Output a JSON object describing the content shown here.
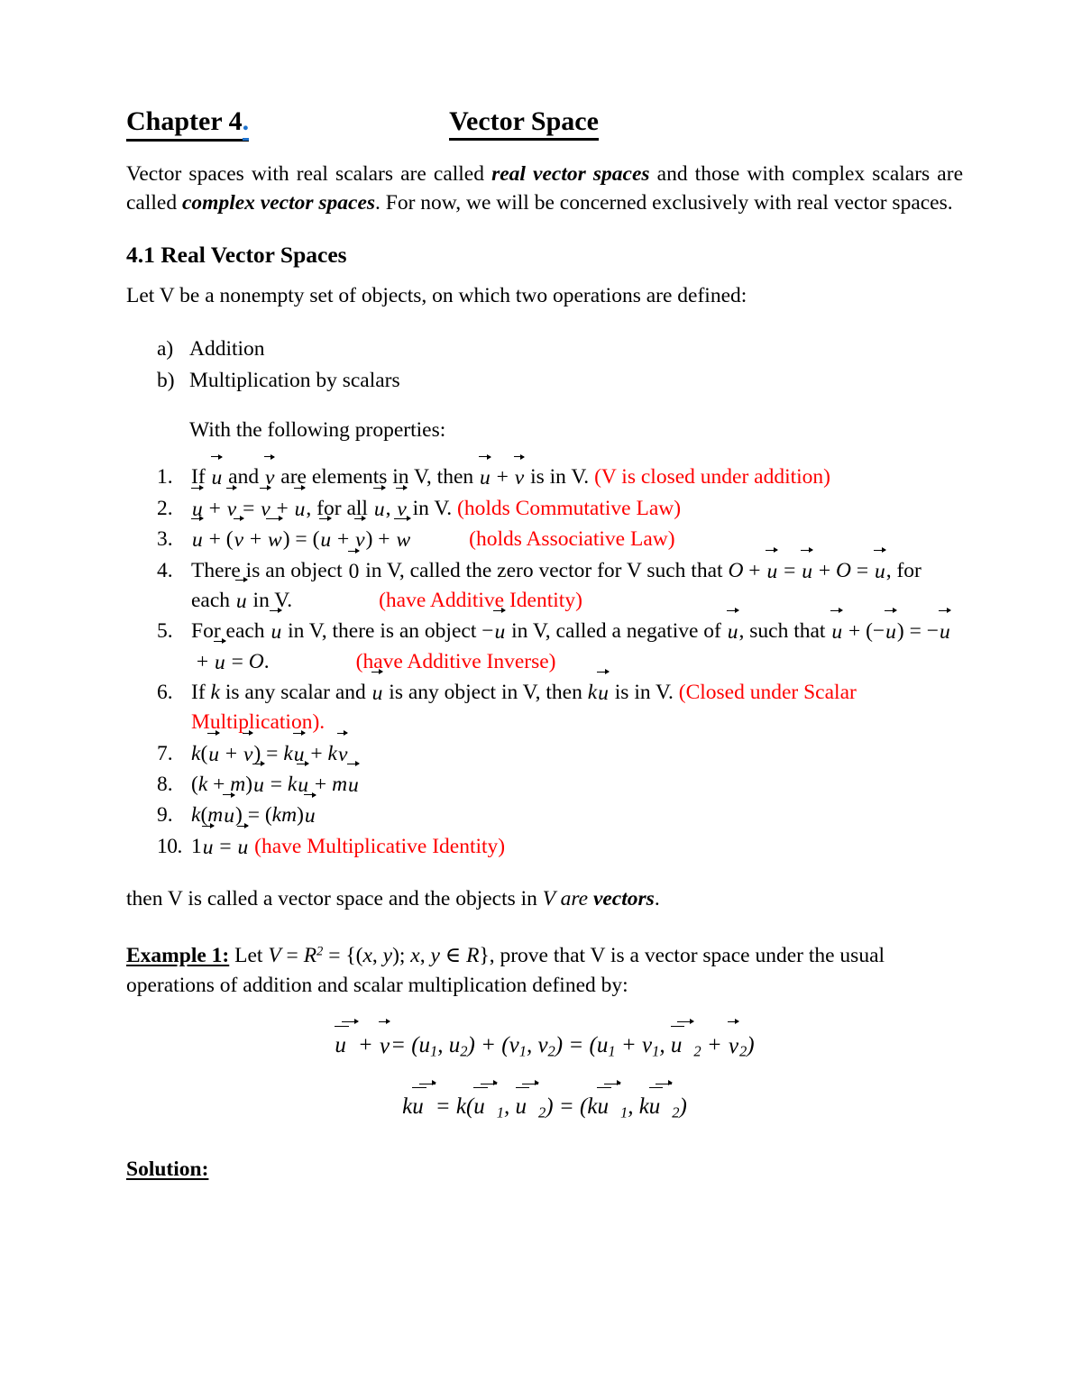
{
  "document": {
    "header": {
      "chapter_label": "Chapter 4",
      "chapter_dot": ".",
      "chapter_dot_color": "#1f72cc",
      "doc_title": "Vector Space"
    },
    "intro_paragraph": {
      "part1": "Vector spaces with real scalars are called ",
      "emph1": "real vector spaces",
      "part2": " and those with complex scalars are called ",
      "emph2": "complex vector spaces",
      "part3": ". For now, we will be concerned exclusively with real vector spaces."
    },
    "section_heading": "4.1 Real Vector Spaces",
    "lead_in": "Let V be a nonempty set of objects, on which two operations are defined:",
    "operations": [
      {
        "marker": "a)",
        "label": "Addition"
      },
      {
        "marker": "b)",
        "label": "Multiplication by scalars"
      }
    ],
    "properties_lead": "With the following properties:",
    "properties": [
      {
        "marker": "1.",
        "text_plain": "If u and v are elements in V, then u + v is in V.",
        "annotation": "(V is closed under addition)"
      },
      {
        "marker": "2.",
        "text_plain": "u + v = v + u, for all u, v in V.",
        "annotation": "(holds Commutative Law)"
      },
      {
        "marker": "3.",
        "text_plain": "u + (v + w) = (u + v) + w",
        "annotation": "(holds Associative Law)"
      },
      {
        "marker": "4.",
        "text_plain": "There is an object 0 in V, called the zero vector for V such that O + u = u + O = u, for each u in V.",
        "annotation": "(have Additive Identity)"
      },
      {
        "marker": "5.",
        "text_plain": "For each u in V, there is an object −u in V, called a negative of u, such that u + (−u) = −u + u = O.",
        "annotation": "(have Additive Inverse)"
      },
      {
        "marker": "6.",
        "text_plain": "If k is any scalar and u is any object in V, then ku is in V.",
        "annotation": "(Closed under Scalar Multiplication)."
      },
      {
        "marker": "7.",
        "text_plain": "k(u + v) = ku + kv",
        "annotation": ""
      },
      {
        "marker": "8.",
        "text_plain": "(k + m)u = ku + mu",
        "annotation": ""
      },
      {
        "marker": "9.",
        "text_plain": "k(mu) = (km)u",
        "annotation": ""
      },
      {
        "marker": "10.",
        "text_plain": "1u = u",
        "annotation": "(have Multiplicative Identity)"
      }
    ],
    "closing_line": {
      "part1": "then V is called a vector space and the objects in ",
      "emph_italic": "V are ",
      "emph_bold": "vectors",
      "part2": "."
    },
    "example": {
      "label": "Example 1:",
      "text_before": " Let ",
      "statement_math": "V = R² = {(x, y); x, y ∈ R}",
      "text_after": ", prove that V is a vector space under the usual operations of addition and scalar multiplication defined by:"
    },
    "equations": [
      "ū⃗ + v⃗ = (u₁, u₂) + (v₁, v₂) = (u₁ + v₁, ū⃗₂ + v⃗₂)",
      "kū⃗ = k(ū⃗₁, ū⃗₂) = (kū⃗₁, kū⃗₂)"
    ],
    "solution_label": "Solution:",
    "colors": {
      "annotation_red": "#fe0000",
      "accent_blue": "#1f72cc",
      "text": "#000000",
      "background": "#ffffff"
    }
  }
}
